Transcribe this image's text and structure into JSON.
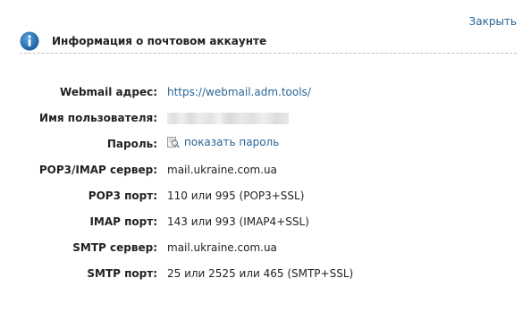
{
  "actions": {
    "close_label": "Закрыть"
  },
  "header": {
    "title": "Информация о почтовом аккаунте",
    "icon": "info-icon",
    "icon_color": "#1f6fb2"
  },
  "fields": {
    "webmail": {
      "label": "Webmail адрес:",
      "value": "https://webmail.adm.tools/"
    },
    "username": {
      "label": "Имя пользователя:",
      "value": ""
    },
    "password": {
      "label": "Пароль:",
      "action_label": "показать пароль",
      "icon": "magnifier-icon"
    },
    "pop3_imap_server": {
      "label": "POP3/IMAP сервер:",
      "value": "mail.ukraine.com.ua"
    },
    "pop3_port": {
      "label": "POP3 порт:",
      "value": "110 или 995 (POP3+SSL)"
    },
    "imap_port": {
      "label": "IMAP порт:",
      "value": "143 или 993 (IMAP4+SSL)"
    },
    "smtp_server": {
      "label": "SMTP сервер:",
      "value": "mail.ukraine.com.ua"
    },
    "smtp_port": {
      "label": "SMTP порт:",
      "value": "25 или 2525 или 465 (SMTP+SSL)"
    }
  },
  "colors": {
    "link": "#2a6496",
    "text": "#222222",
    "divider": "#c4c4c4"
  }
}
